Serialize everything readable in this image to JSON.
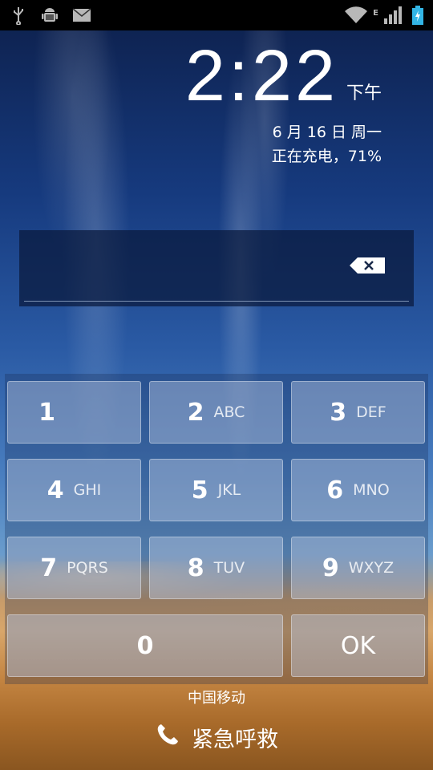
{
  "status_bar": {
    "left_icons": [
      "usb-icon",
      "android-debug-icon",
      "mail-icon"
    ],
    "right_icons": [
      "wifi-icon",
      "network-e-icon",
      "signal-icon",
      "battery-charging-icon"
    ]
  },
  "lock": {
    "time": "2:22",
    "ampm": "下午",
    "date": "6 月 16 日 周一",
    "charging": "正在充电，71%"
  },
  "pin": {
    "value": "",
    "backspace_icon": "backspace-icon"
  },
  "keypad": {
    "k1": {
      "num": "1",
      "letters": ""
    },
    "k2": {
      "num": "2",
      "letters": "ABC"
    },
    "k3": {
      "num": "3",
      "letters": "DEF"
    },
    "k4": {
      "num": "4",
      "letters": "GHI"
    },
    "k5": {
      "num": "5",
      "letters": "JKL"
    },
    "k6": {
      "num": "6",
      "letters": "MNO"
    },
    "k7": {
      "num": "7",
      "letters": "PQRS"
    },
    "k8": {
      "num": "8",
      "letters": "TUV"
    },
    "k9": {
      "num": "9",
      "letters": "WXYZ"
    },
    "k0": {
      "num": "0"
    },
    "ok": "OK"
  },
  "carrier": "中国移动",
  "emergency_call": "紧急呼救",
  "colors": {
    "statusbar": "#000000",
    "battery_accent": "#33b5e5"
  }
}
